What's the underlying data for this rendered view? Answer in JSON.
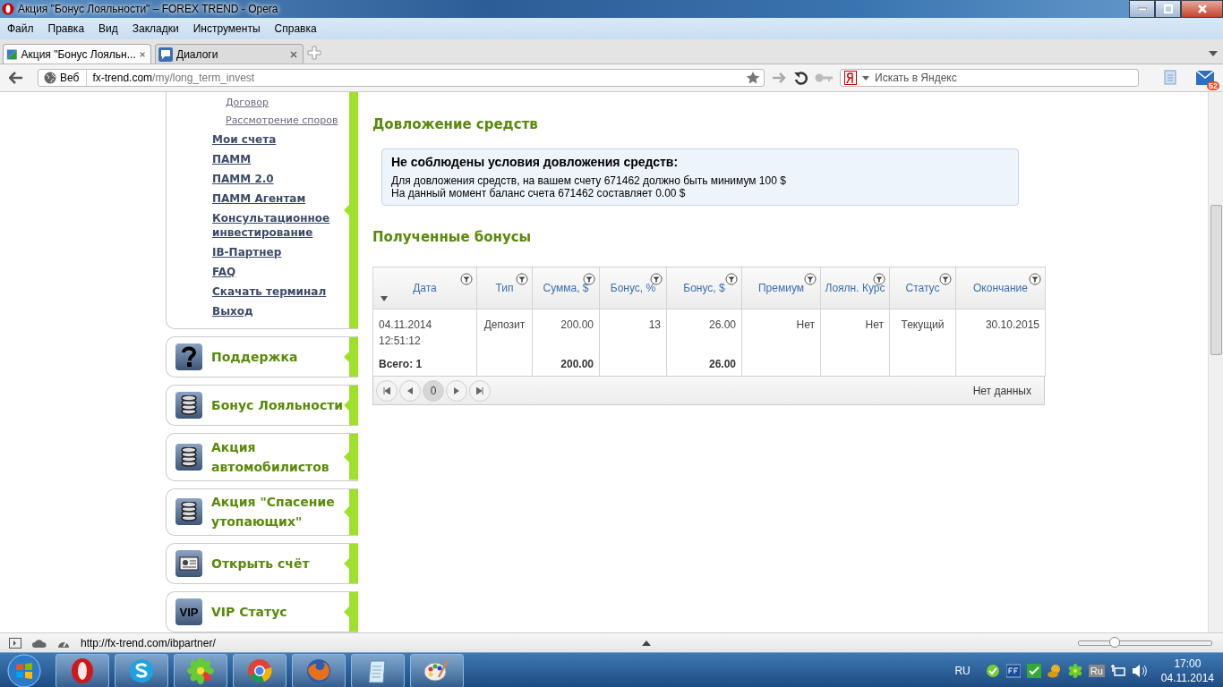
{
  "window": {
    "title": "Акция \"Бонус Лояльности\" – FOREX TREND - Opera"
  },
  "menu": [
    "Файл",
    "Правка",
    "Вид",
    "Закладки",
    "Инструменты",
    "Справка"
  ],
  "tabs": [
    {
      "label": "Акция \"Бонус Лояльн...",
      "selected": true
    },
    {
      "label": "Диалоги",
      "selected": false
    }
  ],
  "address": {
    "site_label": "Веб",
    "host": "fx-trend.com",
    "path": "/my/long_term_invest"
  },
  "search": {
    "placeholder": "Искать в Яндекс"
  },
  "mail_badge": "52",
  "sidebar": {
    "sub_links": [
      "Договор",
      "Рассмотрение споров"
    ],
    "links": [
      "Мои счета",
      "ПАММ",
      "ПАММ 2.0",
      "ПАММ Агентам",
      "Консультационное инвестирование",
      "IB-Партнер",
      "FAQ",
      "Скачать терминал",
      "Выход"
    ],
    "panels": [
      {
        "kind": "question",
        "label": "Поддержка"
      },
      {
        "kind": "coins",
        "label": "Бонус Лояльности"
      },
      {
        "kind": "coins",
        "label": "Акция автомобилистов"
      },
      {
        "kind": "coins",
        "label": "Акция \"Спасение утопающих\""
      },
      {
        "kind": "card",
        "label": "Открыть счёт"
      },
      {
        "kind": "vip",
        "label": "VIP Статус",
        "icon_text": "VIP"
      }
    ]
  },
  "topup": {
    "heading": "Довложение средств",
    "notice_title": "Не соблюдены условия довложения средств:",
    "notice_lines": [
      "Для довложения средств, на вашем счету 671462 должно быть минимум 100 $",
      "На данный момент баланс счета 671462 составляет 0.00 $"
    ]
  },
  "bonuses": {
    "heading": "Полученные бонусы",
    "columns": [
      {
        "label": "Дата",
        "sorted": true
      },
      {
        "label": "Тип",
        "sorted": false
      },
      {
        "label": "Сумма, $",
        "sorted": false
      },
      {
        "label": "Бонус, %",
        "sorted": false
      },
      {
        "label": "Бонус, $",
        "sorted": false
      },
      {
        "label": "Премиум",
        "sorted": false
      },
      {
        "label": "Лоялн. Курс",
        "sorted": false
      },
      {
        "label": "Статус",
        "sorted": false
      },
      {
        "label": "Окончание",
        "sorted": false
      }
    ],
    "rows": [
      [
        "04.11.2014 12:51:12",
        "Депозит",
        "200.00",
        "13",
        "26.00",
        "Нет",
        "Нет",
        "Текущий",
        "30.10.2015"
      ]
    ],
    "totals": {
      "label": "Всего: 1",
      "amount": "200.00",
      "bonus": "26.00"
    },
    "pager": {
      "page": "0",
      "info": "Нет данных"
    }
  },
  "status_bar": {
    "url": "http://fx-trend.com/ibpartner/",
    "zoom": {
      "level": 0.27
    }
  },
  "taskbar": {
    "apps": [
      {
        "kind": "opera"
      },
      {
        "kind": "skype"
      },
      {
        "kind": "flower"
      },
      {
        "kind": "chrome"
      },
      {
        "kind": "firefox"
      },
      {
        "kind": "notepad"
      },
      {
        "kind": "paint"
      }
    ],
    "language": "RU",
    "tray_lang_icon": "Ru",
    "time": "17:00",
    "date": "04.11.2014"
  }
}
